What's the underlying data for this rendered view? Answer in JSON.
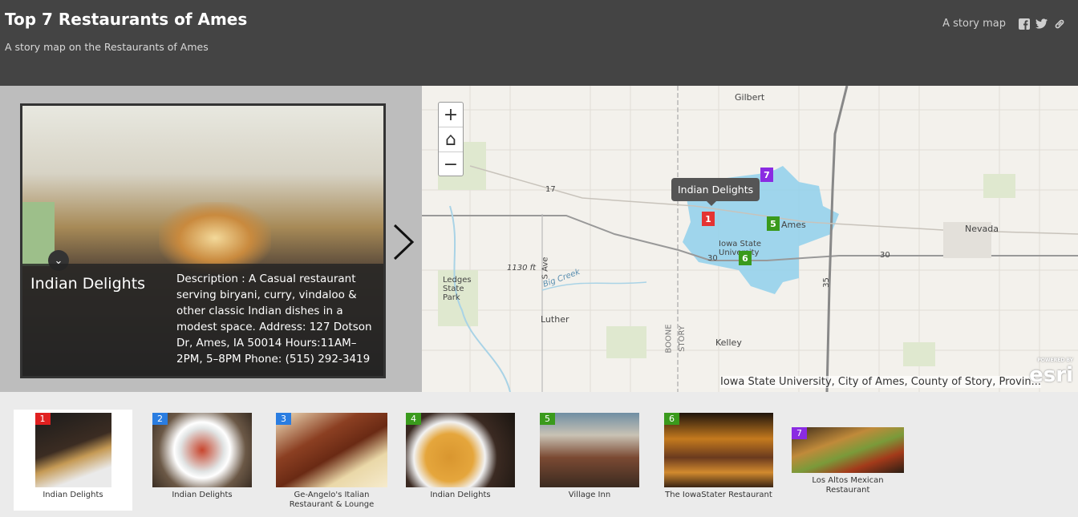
{
  "header": {
    "title": "Top 7 Restaurants of Ames",
    "subtitle": "A story map on the Restaurants of Ames",
    "story_map_label": "A story map",
    "icons": [
      "facebook-icon",
      "twitter-icon",
      "link-icon"
    ]
  },
  "feature": {
    "title": "Indian Delights",
    "description": "Description : A Casual restaurant serving biryani, curry, vindaloo & other classic Indian dishes in a modest space. Address: 127 Dotson Dr, Ames, IA 50014 Hours:11AM–2PM, 5–8PM Phone: (515) 292-3419"
  },
  "map": {
    "zoom_in": "+",
    "home": "⌂",
    "zoom_out": "−",
    "tooltip": "Indian Delights",
    "attribution": "Iowa State University, City of Ames, County of Story, Provin...",
    "esri_small": "POWERED BY",
    "esri": "esri",
    "labels": {
      "gilbert": "Gilbert",
      "nevada": "Nevada",
      "isu": "Iowa State University",
      "ledges": "Ledges State Park",
      "luther": "Luther",
      "kelley": "Kelley",
      "elev": "1130 ft",
      "s_ave": "S Ave",
      "bigcreek": "Big Creek",
      "boone": "BOONE",
      "story": "STORY",
      "r30a": "30",
      "r30b": "30",
      "r35": "35",
      "r17": "17",
      "ames": "Ames"
    },
    "pins": [
      {
        "num": "1",
        "color": "#e53333"
      },
      {
        "num": "5",
        "color": "#3a9a1c"
      },
      {
        "num": "6",
        "color": "#3a9a1c"
      },
      {
        "num": "7",
        "color": "#8a2be2"
      }
    ]
  },
  "carousel": [
    {
      "num": "1",
      "color": "#e02020",
      "label": "Indian Delights"
    },
    {
      "num": "2",
      "color": "#2a7de1",
      "label": "Indian Delights"
    },
    {
      "num": "3",
      "color": "#2a7de1",
      "label": "Ge-Angelo's Italian Restaurant & Lounge"
    },
    {
      "num": "4",
      "color": "#3a9a1c",
      "label": "Indian Delights"
    },
    {
      "num": "5",
      "color": "#3a9a1c",
      "label": "Village Inn"
    },
    {
      "num": "6",
      "color": "#3a9a1c",
      "label": "The IowaStater Restaurant"
    },
    {
      "num": "7",
      "color": "#8a2be2",
      "label": "Los Altos Mexican Restaurant"
    }
  ]
}
